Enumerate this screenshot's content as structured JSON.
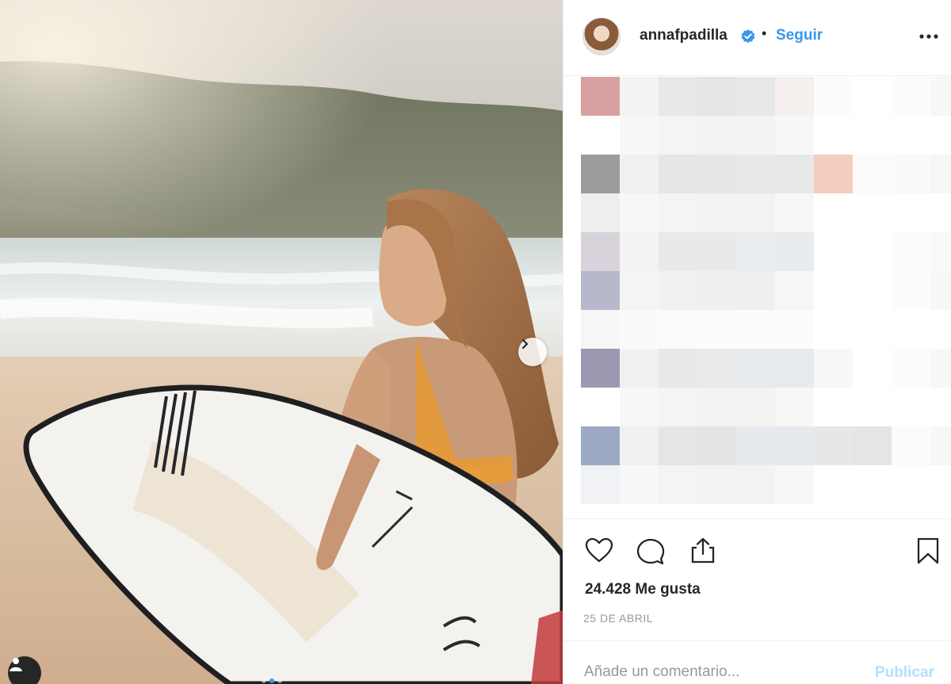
{
  "post": {
    "username": "annafpadilla",
    "separator": "•",
    "follow_label": "Seguir",
    "likes_text": "24.428 Me gusta",
    "date_text": "25 DE ABRIL",
    "comment_placeholder": "Añade un comentario...",
    "publish_label": "Publicar"
  },
  "carousel": {
    "current_index": 1,
    "total_slides": 3
  },
  "icons": {
    "verified": "verified-badge-icon",
    "more": "more-options-icon",
    "like": "heart-icon",
    "comment": "comment-bubble-icon",
    "share": "share-icon",
    "save": "bookmark-icon",
    "next": "chevron-right-icon",
    "user_tag": "user-icon"
  },
  "colors": {
    "link_blue": "#3897f0",
    "publish_disabled": "#b2dffc",
    "verified_blue": "#3897f0",
    "text": "#262626",
    "muted": "#999999"
  },
  "comments_pixelated": {
    "rows": [
      [
        "#d8a0a2",
        "#f3f3f3",
        "#e8e8e8",
        "#e5e5e5",
        "#e8e8e8",
        "#f5f0ee",
        "#fefbfb",
        "#ffffff",
        "#fcfcfc",
        "#f7f7f7"
      ],
      [
        "#ffffff",
        "#f7f7f7",
        "#f4f4f4",
        "#f3f3f3",
        "#f3f3f3",
        "#f7f7f7",
        "#ffffff",
        "#ffffff",
        "#ffffff",
        "#ffffff"
      ],
      [
        "#9c9c9c",
        "#f0f0f0",
        "#e6e6e6",
        "#e6e6e6",
        "#e8e8e8",
        "#e8e8e8",
        "#f3cdc0",
        "#fdfafa",
        "#fafafa",
        "#f6f6f6"
      ],
      [
        "#eeeeee",
        "#f7f7f7",
        "#f4f4f4",
        "#f2f2f2",
        "#f2f2f2",
        "#f7f7f7",
        "#ffffff",
        "#ffffff",
        "#ffffff",
        "#ffffff"
      ],
      [
        "#d8d3db",
        "#f3f3f3",
        "#e9e9e9",
        "#e9e9e9",
        "#e9edf0",
        "#e8ecef",
        "#ffffff",
        "#ffffff",
        "#fcfcfc",
        "#f9f9f9"
      ],
      [
        "#b8b8cc",
        "#f4f4f4",
        "#f1f1f1",
        "#efefef",
        "#efefef",
        "#f6f6f6",
        "#ffffff",
        "#ffffff",
        "#fcfcfc",
        "#f7f7f7"
      ],
      [
        "#f6f6f6",
        "#fafafa",
        "#fbfbfb",
        "#fbfbfb",
        "#fcfcfc",
        "#fcfcfc",
        "#ffffff",
        "#ffffff",
        "#ffffff",
        "#ffffff"
      ],
      [
        "#9c98b1",
        "#f1f1f1",
        "#e8e8e8",
        "#eaeaea",
        "#e6ebef",
        "#e7ebee",
        "#f5f7f9",
        "#ffffff",
        "#fcfcfc",
        "#f7f7f7"
      ],
      [
        "#ffffff",
        "#f7f7f7",
        "#f4f4f4",
        "#f3f3f3",
        "#f3f3f3",
        "#f7f7f7",
        "#ffffff",
        "#ffffff",
        "#ffffff",
        "#ffffff"
      ],
      [
        "#9eaac5",
        "#f1f1f1",
        "#e5e5e5",
        "#e4e4e4",
        "#e6eaee",
        "#e6eaee",
        "#e7e7e7",
        "#e5e5e5",
        "#fbfbfb",
        "#f7f7f7"
      ],
      [
        "#f0f2f6",
        "#f8f8f8",
        "#f4f4f4",
        "#f2f2f2",
        "#f3f3f3",
        "#f8f8f8",
        "#ffffff",
        "#ffffff",
        "#ffffff",
        "#ffffff"
      ]
    ]
  }
}
